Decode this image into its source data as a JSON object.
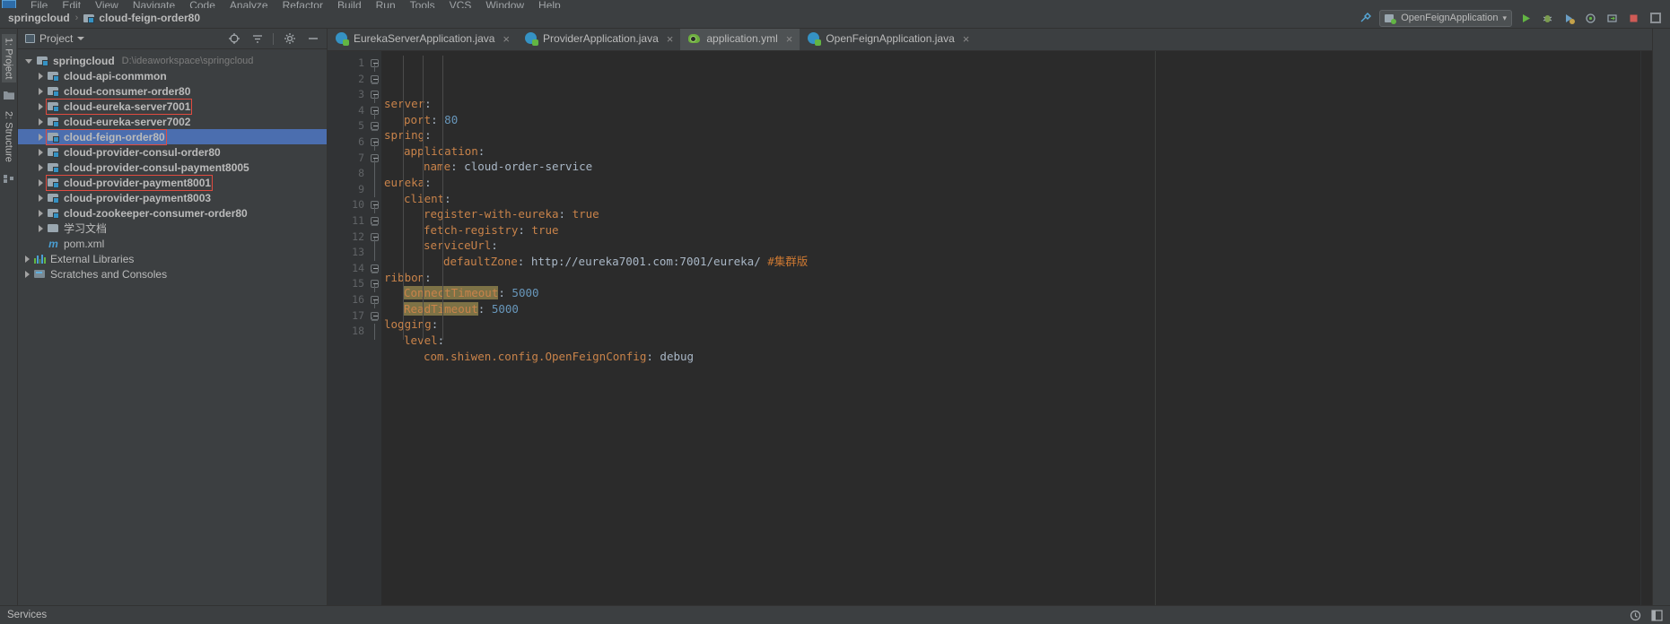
{
  "window": {
    "menu_items": [
      "File",
      "Edit",
      "View",
      "Navigate",
      "Code",
      "Analyze",
      "Refactor",
      "Build",
      "Run",
      "Tools",
      "VCS",
      "Window",
      "Help"
    ],
    "app_icon_name": "intellij-idea-logo"
  },
  "navbar": {
    "project_name": "springcloud",
    "separator": "›",
    "current_module": "cloud-feign-order80",
    "run_config_name": "OpenFeignApplication",
    "run_config_caret": "▾",
    "actions": [
      {
        "name": "build-hammer-icon",
        "glyph": "⚒"
      },
      {
        "name": "run-button",
        "glyph": "▶",
        "color": "#62b543"
      },
      {
        "name": "debug-button",
        "glyph": "🐞"
      },
      {
        "name": "run-with-coverage-button",
        "glyph": "⏵"
      },
      {
        "name": "profile-button",
        "glyph": "◎"
      },
      {
        "name": "attach-process-button",
        "glyph": "⮌"
      },
      {
        "name": "stop-button",
        "glyph": "■",
        "color": "#cf5b56"
      },
      {
        "name": "search-everywhere-icon",
        "glyph": "⛶"
      }
    ]
  },
  "left_stripe": {
    "tabs": [
      {
        "name": "tool-window-project",
        "label": "1: Project",
        "active": true
      },
      {
        "name": "tool-window-structure",
        "label": "2: Structure",
        "active": false
      }
    ]
  },
  "project_pane": {
    "title": "Project",
    "caret": "▾",
    "actions": [
      {
        "name": "select-opened-file-icon",
        "glyph": "⌖"
      },
      {
        "name": "collapse-all-icon",
        "glyph": "≡"
      },
      {
        "name": "settings-gear-icon",
        "glyph": "⚙"
      },
      {
        "name": "hide-icon",
        "glyph": "—"
      }
    ],
    "tree": [
      {
        "label": "springcloud",
        "path": "D:\\ideaworkspace\\springcloud",
        "icon": "module-icon",
        "depth": 0,
        "arrow": "open",
        "bold": true,
        "selected": false,
        "outlined": false
      },
      {
        "label": "cloud-api-conmmon",
        "path": "",
        "icon": "module-icon",
        "depth": 1,
        "arrow": "closed",
        "bold": true,
        "selected": false,
        "outlined": false
      },
      {
        "label": "cloud-consumer-order80",
        "path": "",
        "icon": "module-icon",
        "depth": 1,
        "arrow": "closed",
        "bold": true,
        "selected": false,
        "outlined": false
      },
      {
        "label": "cloud-eureka-server7001",
        "path": "",
        "icon": "module-icon",
        "depth": 1,
        "arrow": "closed",
        "bold": true,
        "selected": false,
        "outlined": true
      },
      {
        "label": "cloud-eureka-server7002",
        "path": "",
        "icon": "module-icon",
        "depth": 1,
        "arrow": "closed",
        "bold": true,
        "selected": false,
        "outlined": false
      },
      {
        "label": "cloud-feign-order80",
        "path": "",
        "icon": "module-icon",
        "depth": 1,
        "arrow": "closed",
        "bold": true,
        "selected": true,
        "outlined": true
      },
      {
        "label": "cloud-provider-consul-order80",
        "path": "",
        "icon": "module-icon",
        "depth": 1,
        "arrow": "closed",
        "bold": true,
        "selected": false,
        "outlined": false
      },
      {
        "label": "cloud-provider-consul-payment8005",
        "path": "",
        "icon": "module-icon",
        "depth": 1,
        "arrow": "closed",
        "bold": true,
        "selected": false,
        "outlined": false
      },
      {
        "label": "cloud-provider-payment8001",
        "path": "",
        "icon": "module-icon",
        "depth": 1,
        "arrow": "closed",
        "bold": true,
        "selected": false,
        "outlined": true
      },
      {
        "label": "cloud-provider-payment8003",
        "path": "",
        "icon": "module-icon",
        "depth": 1,
        "arrow": "closed",
        "bold": true,
        "selected": false,
        "outlined": false
      },
      {
        "label": "cloud-zookeeper-consumer-order80",
        "path": "",
        "icon": "module-icon",
        "depth": 1,
        "arrow": "closed",
        "bold": true,
        "selected": false,
        "outlined": false
      },
      {
        "label": "学习文档",
        "path": "",
        "icon": "folder-icon",
        "depth": 1,
        "arrow": "closed",
        "bold": false,
        "selected": false,
        "outlined": false
      },
      {
        "label": "pom.xml",
        "path": "",
        "icon": "maven-icon",
        "depth": 1,
        "arrow": "none",
        "bold": false,
        "selected": false,
        "outlined": false
      },
      {
        "label": "External Libraries",
        "path": "",
        "icon": "library-icon",
        "depth": 0,
        "arrow": "closed",
        "bold": false,
        "selected": false,
        "outlined": false
      },
      {
        "label": "Scratches and Consoles",
        "path": "",
        "icon": "scratch-icon",
        "depth": 0,
        "arrow": "closed",
        "bold": false,
        "selected": false,
        "outlined": false
      }
    ]
  },
  "editor_tabs": [
    {
      "label": "EurekaServerApplication.java",
      "icon": "java-class-icon",
      "active": false,
      "close": "×"
    },
    {
      "label": "ProviderApplication.java",
      "icon": "java-class-icon",
      "active": false,
      "close": "×"
    },
    {
      "label": "application.yml",
      "icon": "yaml-file-icon",
      "active": true,
      "close": "×"
    },
    {
      "label": "OpenFeignApplication.java",
      "icon": "java-class-icon",
      "active": false,
      "close": "×"
    }
  ],
  "editor": {
    "file": "application.yml",
    "line_count": 18,
    "line_numbers": [
      "1",
      "2",
      "3",
      "4",
      "5",
      "6",
      "7",
      "8",
      "9",
      "10",
      "11",
      "12",
      "13",
      "14",
      "15",
      "16",
      "17",
      "18"
    ],
    "lines": [
      {
        "n": 1,
        "indent": 0,
        "fold": "start",
        "tokens": [
          {
            "t": "server",
            "c": "k"
          },
          {
            "t": ":",
            "c": "p"
          }
        ]
      },
      {
        "n": 2,
        "indent": 1,
        "fold": "end",
        "tokens": [
          {
            "t": "port",
            "c": "k"
          },
          {
            "t": ": ",
            "c": "p"
          },
          {
            "t": "80",
            "c": "num"
          }
        ]
      },
      {
        "n": 3,
        "indent": 0,
        "fold": "start",
        "tokens": [
          {
            "t": "spring",
            "c": "k"
          },
          {
            "t": ":",
            "c": "p"
          }
        ]
      },
      {
        "n": 4,
        "indent": 1,
        "fold": "start",
        "tokens": [
          {
            "t": "application",
            "c": "k"
          },
          {
            "t": ":",
            "c": "p"
          }
        ]
      },
      {
        "n": 5,
        "indent": 2,
        "fold": "end",
        "tokens": [
          {
            "t": "name",
            "c": "k"
          },
          {
            "t": ": ",
            "c": "p"
          },
          {
            "t": "cloud-order-service",
            "c": "v"
          }
        ]
      },
      {
        "n": 6,
        "indent": 0,
        "fold": "start",
        "tokens": [
          {
            "t": "eureka",
            "c": "k"
          },
          {
            "t": ":",
            "c": "p"
          }
        ]
      },
      {
        "n": 7,
        "indent": 1,
        "fold": "start",
        "tokens": [
          {
            "t": "client",
            "c": "k"
          },
          {
            "t": ":",
            "c": "p"
          }
        ]
      },
      {
        "n": 8,
        "indent": 2,
        "fold": "none",
        "tokens": [
          {
            "t": "register-with-eureka",
            "c": "k"
          },
          {
            "t": ": ",
            "c": "p"
          },
          {
            "t": "true",
            "c": "bool"
          }
        ]
      },
      {
        "n": 9,
        "indent": 2,
        "fold": "none",
        "tokens": [
          {
            "t": "fetch-registry",
            "c": "k"
          },
          {
            "t": ": ",
            "c": "p"
          },
          {
            "t": "true",
            "c": "bool"
          }
        ]
      },
      {
        "n": 10,
        "indent": 2,
        "fold": "start",
        "tokens": [
          {
            "t": "serviceUrl",
            "c": "k"
          },
          {
            "t": ":",
            "c": "p"
          }
        ]
      },
      {
        "n": 11,
        "indent": 3,
        "fold": "end",
        "tokens": [
          {
            "t": "defaultZone",
            "c": "k"
          },
          {
            "t": ": ",
            "c": "p"
          },
          {
            "t": "http://eureka7001.com:7001/eureka/ ",
            "c": "v"
          },
          {
            "t": "#集群版",
            "c": "cmt"
          }
        ]
      },
      {
        "n": 12,
        "indent": 0,
        "fold": "start",
        "tokens": [
          {
            "t": "ribbon",
            "c": "k"
          },
          {
            "t": ":",
            "c": "p"
          }
        ]
      },
      {
        "n": 13,
        "indent": 1,
        "fold": "none",
        "tokens": [
          {
            "t": "ConnectTimeout",
            "c": "hl"
          },
          {
            "t": ": ",
            "c": "p"
          },
          {
            "t": "5000",
            "c": "num"
          }
        ]
      },
      {
        "n": 14,
        "indent": 1,
        "fold": "end",
        "tokens": [
          {
            "t": "ReadTimeout",
            "c": "hl"
          },
          {
            "t": ": ",
            "c": "p"
          },
          {
            "t": "5000",
            "c": "num"
          }
        ]
      },
      {
        "n": 15,
        "indent": 0,
        "fold": "start",
        "tokens": [
          {
            "t": "logging",
            "c": "k"
          },
          {
            "t": ":",
            "c": "p"
          }
        ]
      },
      {
        "n": 16,
        "indent": 1,
        "fold": "start",
        "tokens": [
          {
            "t": "level",
            "c": "k"
          },
          {
            "t": ":",
            "c": "p"
          }
        ]
      },
      {
        "n": 17,
        "indent": 2,
        "fold": "end",
        "tokens": [
          {
            "t": "com.shiwen.config.OpenFeignConfig",
            "c": "k"
          },
          {
            "t": ": ",
            "c": "p"
          },
          {
            "t": "debug",
            "c": "v"
          }
        ]
      },
      {
        "n": 18,
        "indent": 0,
        "fold": "none",
        "tokens": []
      }
    ]
  },
  "statusbar": {
    "left_label": "Services",
    "right_icons": [
      {
        "name": "event-log-icon",
        "glyph": "☉"
      },
      {
        "name": "layout-settings-icon",
        "glyph": "▤"
      }
    ]
  },
  "colors": {
    "accent_selection": "#4b6eaf",
    "panel_bg": "#3c3f41",
    "editor_bg": "#2b2b2b",
    "gutter_bg": "#313335",
    "key_orange": "#c9834a",
    "value_gray": "#a9b7c6",
    "number_blue": "#6897bb",
    "comment_orange": "#cc7832",
    "highlight_olive": "#7d7246",
    "outline_red": "#e04b40",
    "run_green": "#62b543",
    "stop_red": "#cf5b56"
  }
}
